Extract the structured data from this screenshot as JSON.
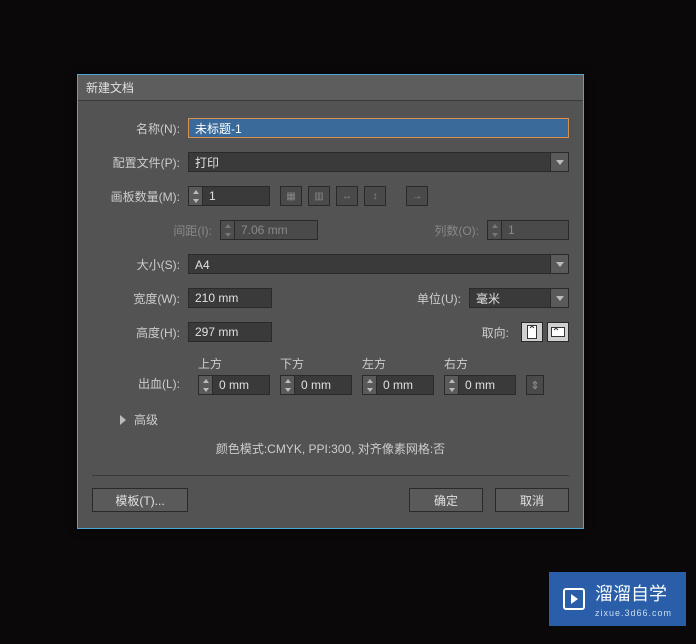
{
  "dialog": {
    "title": "新建文档",
    "name": {
      "label": "名称(N):",
      "value": "未标题-1"
    },
    "profile": {
      "label": "配置文件(P):",
      "value": "打印"
    },
    "artboards": {
      "label": "画板数量(M):",
      "value": "1"
    },
    "spacing": {
      "label": "间距(I):",
      "value": "7.06 mm"
    },
    "columns": {
      "label": "列数(O):",
      "value": "1"
    },
    "size": {
      "label": "大小(S):",
      "value": "A4"
    },
    "width": {
      "label": "宽度(W):",
      "value": "210 mm"
    },
    "units": {
      "label": "单位(U):",
      "value": "毫米"
    },
    "height": {
      "label": "高度(H):",
      "value": "297 mm"
    },
    "orientation": {
      "label": "取向:"
    },
    "bleed": {
      "label": "出血(L):",
      "top": {
        "label": "上方",
        "value": "0 mm"
      },
      "bottom": {
        "label": "下方",
        "value": "0 mm"
      },
      "left": {
        "label": "左方",
        "value": "0 mm"
      },
      "right": {
        "label": "右方",
        "value": "0 mm"
      }
    },
    "advanced": {
      "label": "高级"
    },
    "summary": "颜色模式:CMYK, PPI:300, 对齐像素网格:否",
    "footer": {
      "templates": "模板(T)...",
      "ok": "确定",
      "cancel": "取消"
    }
  },
  "watermark": {
    "brand": "溜溜自学",
    "url": "zixue.3d66.com"
  }
}
